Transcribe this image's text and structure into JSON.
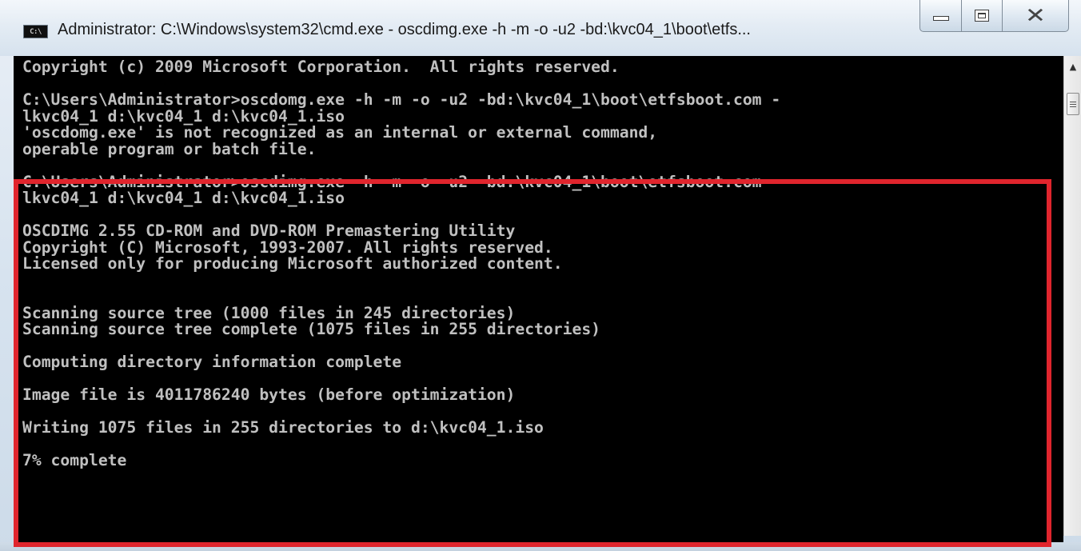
{
  "window": {
    "title": "Administrator: C:\\Windows\\system32\\cmd.exe - oscdimg.exe  -h -m -o -u2 -bd:\\kvc04_1\\boot\\etfs...",
    "icon_label": "C:\\",
    "icon": "cmd-console-icon",
    "controls": [
      "minimize-icon",
      "maximize-icon",
      "close-icon"
    ]
  },
  "console": {
    "lines": [
      "Copyright (c) 2009 Microsoft Corporation.  All rights reserved.",
      "",
      "C:\\Users\\Administrator>oscdomg.exe -h -m -o -u2 -bd:\\kvc04_1\\boot\\etfsboot.com -",
      "lkvc04_1 d:\\kvc04_1 d:\\kvc04_1.iso",
      "'oscdomg.exe' is not recognized as an internal or external command,",
      "operable program or batch file.",
      "",
      "C:\\Users\\Administrator>oscdimg.exe -h -m -o -u2 -bd:\\kvc04_1\\boot\\etfsboot.com -",
      "lkvc04_1 d:\\kvc04_1 d:\\kvc04_1.iso",
      "",
      "OSCDIMG 2.55 CD-ROM and DVD-ROM Premastering Utility",
      "Copyright (C) Microsoft, 1993-2007. All rights reserved.",
      "Licensed only for producing Microsoft authorized content.",
      "",
      "",
      "Scanning source tree (1000 files in 245 directories)",
      "Scanning source tree complete (1075 files in 255 directories)",
      "",
      "Computing directory information complete",
      "",
      "Image file is 4011786240 bytes (before optimization)",
      "",
      "Writing 1075 files in 255 directories to d:\\kvc04_1.iso",
      "",
      "7% complete"
    ],
    "progress_percent": 7
  },
  "colors": {
    "console_bg": "#000000",
    "console_fg": "#c0c0c0",
    "highlight": "#e0252d"
  }
}
